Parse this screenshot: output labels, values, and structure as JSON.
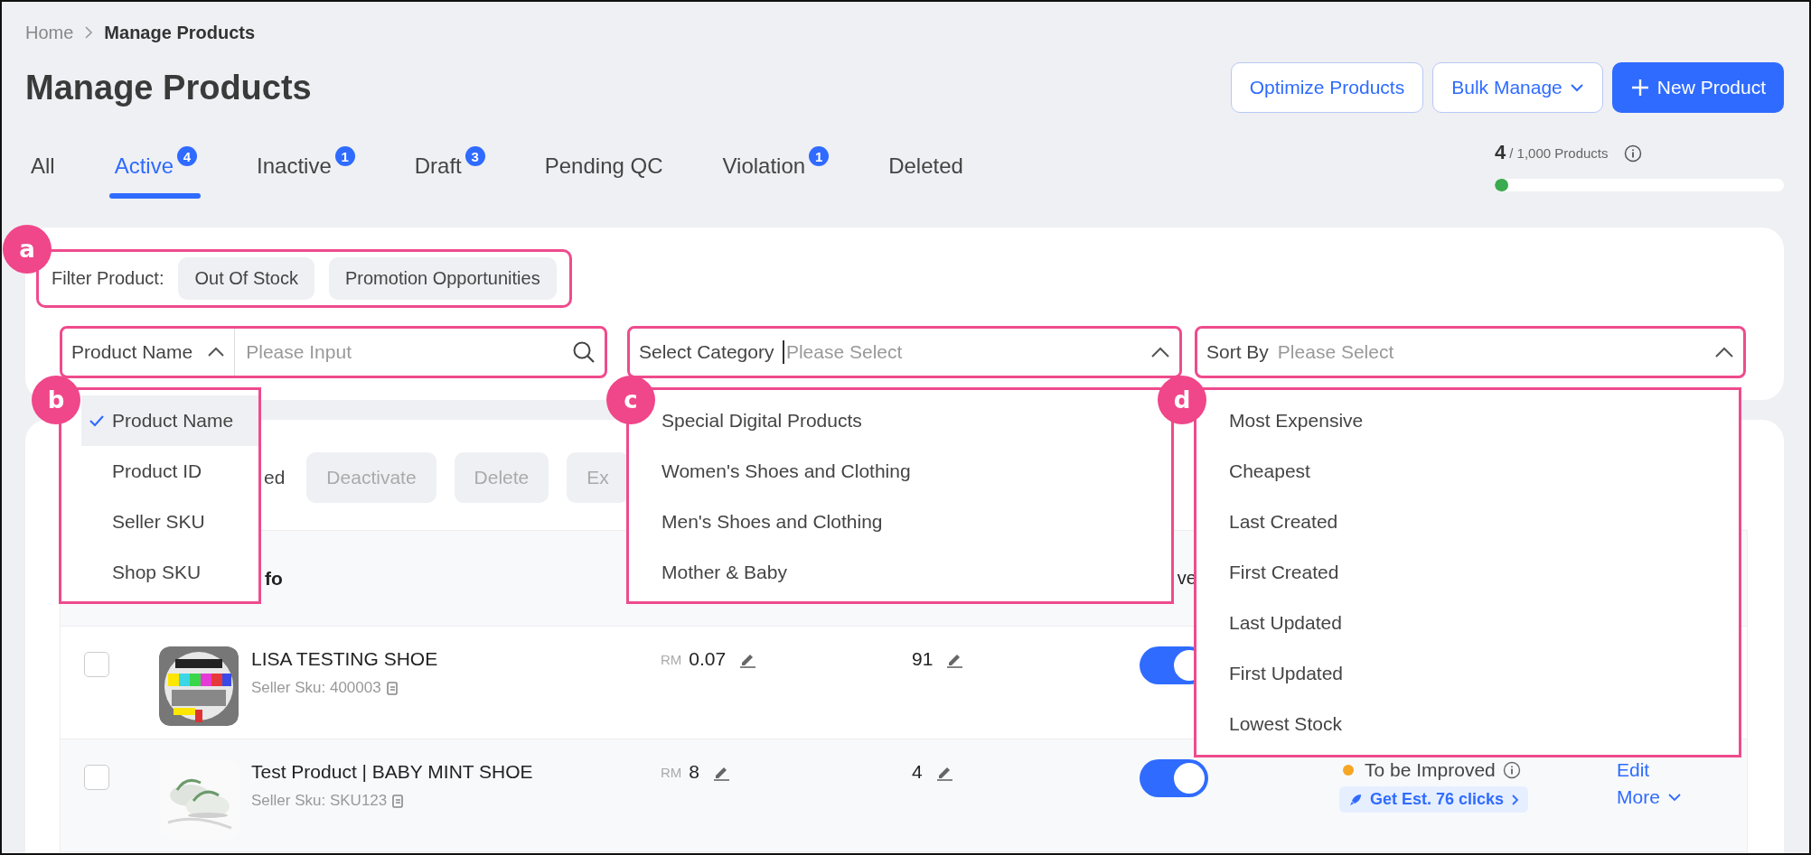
{
  "breadcrumb": [
    {
      "label": "Home"
    },
    {
      "label": "Manage Products"
    }
  ],
  "title": "Manage Products",
  "actions": [
    {
      "label": "Optimize Products",
      "kind": "outline"
    },
    {
      "label": "Bulk Manage",
      "kind": "dropdown"
    },
    {
      "label": "New Product",
      "kind": "primary"
    }
  ],
  "tabs": [
    {
      "label": "All",
      "selected": false
    },
    {
      "label": "Active",
      "count": "4",
      "selected": true
    },
    {
      "label": "Inactive",
      "count": "1",
      "selected": false
    },
    {
      "label": "Draft",
      "count": "3",
      "selected": false
    },
    {
      "label": "Pending QC",
      "selected": false
    },
    {
      "label": "Violation",
      "count": "1",
      "selected": false
    },
    {
      "label": "Deleted",
      "selected": false
    }
  ],
  "quota": {
    "used": "4",
    "total": "/ 1,000 Products",
    "level": 0.004
  },
  "filter": {
    "callout": "a",
    "label": "Filter Product:",
    "chips": [
      "Out Of Stock",
      "Promotion Opportunities"
    ]
  },
  "search": {
    "field": "Product Name",
    "placeholder": "Please Input",
    "expanded": true,
    "callout": "b",
    "options": [
      {
        "label": "Product Name",
        "selected": true
      },
      {
        "label": "Product ID",
        "selected": false
      },
      {
        "label": "Seller SKU",
        "selected": false
      },
      {
        "label": "Shop SKU",
        "selected": false
      }
    ]
  },
  "category": {
    "label": "Select Category",
    "placeholder": "Please Select",
    "expanded": true,
    "callout": "c",
    "options": [
      "Special Digital Products",
      "Women's Shoes and Clothing",
      "Men's Shoes and Clothing",
      "Mother & Baby"
    ]
  },
  "sort": {
    "label": "Sort By",
    "placeholder": "Please Select",
    "expanded": true,
    "callout": "d",
    "options": [
      "Most Expensive",
      "Cheapest",
      "Last Created",
      "First Created",
      "Last Updated",
      "First Updated",
      "Lowest Stock"
    ]
  },
  "bulk": {
    "selected_text": "ed",
    "buttons": [
      "Deactivate",
      "Delete",
      "Ex"
    ]
  },
  "columns": {
    "column_1": "fo",
    "column_2": "ve"
  },
  "products": [
    {
      "name": "LISA TESTING SHOE",
      "sku": "Seller Sku: 400003",
      "currency": "RM",
      "price": "0.07",
      "stock": "91",
      "checked": false,
      "on": true
    },
    {
      "name": "Test Product | BABY MINT SHOE",
      "sku": "Seller Sku: SKU123",
      "currency": "RM",
      "price": "8",
      "stock": "4",
      "checked": false,
      "on": true,
      "status": "To be Improved",
      "color": "#f5a623",
      "promo": "Get Est. 76 clicks",
      "links": [
        "Edit",
        "More"
      ]
    }
  ]
}
